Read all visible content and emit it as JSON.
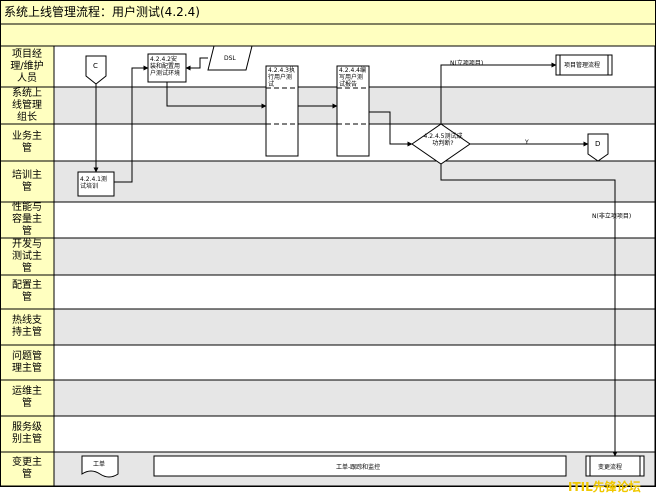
{
  "header": {
    "title": "系统上线管理流程：用户测试(4.2.4)",
    "band_color": "#ffffc0"
  },
  "colors": {
    "lane_white": "#ffffff",
    "lane_gray": "#e6e6e6",
    "label_bg": "#ffffc0",
    "line": "#000000",
    "watermark": "#f0c800"
  },
  "lanes": [
    {
      "label": "项目经\n理/维护\n人员",
      "shaded": false
    },
    {
      "label": "系统上\n线管理\n组长",
      "shaded": true
    },
    {
      "label": "业务主\n管",
      "shaded": false
    },
    {
      "label": "培训主\n管",
      "shaded": true
    },
    {
      "label": "性能与\n容量主\n管",
      "shaded": false
    },
    {
      "label": "开发与\n测试主\n管",
      "shaded": true
    },
    {
      "label": "配置主\n管",
      "shaded": false
    },
    {
      "label": "热线支\n持主管",
      "shaded": true
    },
    {
      "label": "问题管\n理主管",
      "shaded": false
    },
    {
      "label": "运维主\n管",
      "shaded": true
    },
    {
      "label": "服务级\n别主管",
      "shaded": false
    },
    {
      "label": "变更主\n管",
      "shaded": true
    }
  ],
  "nodes": {
    "connector_c": "C",
    "step_425": "4.2.4.2安\n装和配置用\n户测试环境",
    "dsl": "DSL",
    "step_423": "4.2.4.3执\n行用户测\n试",
    "step_424": "4.2.4.4编\n写用户测\n试报告",
    "project_process": "项目管理流程",
    "step_421": "4.2.4.1测\n试培训",
    "decision": "4.2.4.5测试成\n功判断?",
    "connector_d": "D",
    "ticket": "工单",
    "ticket_monitor": "工单-跟踪和监控",
    "change_process": "变更流程"
  },
  "edges": {
    "n_project": "N(立项项目)",
    "yes": "Y",
    "n_non_project": "N(非立项项目)"
  },
  "watermark": "ITIL先锋论坛"
}
